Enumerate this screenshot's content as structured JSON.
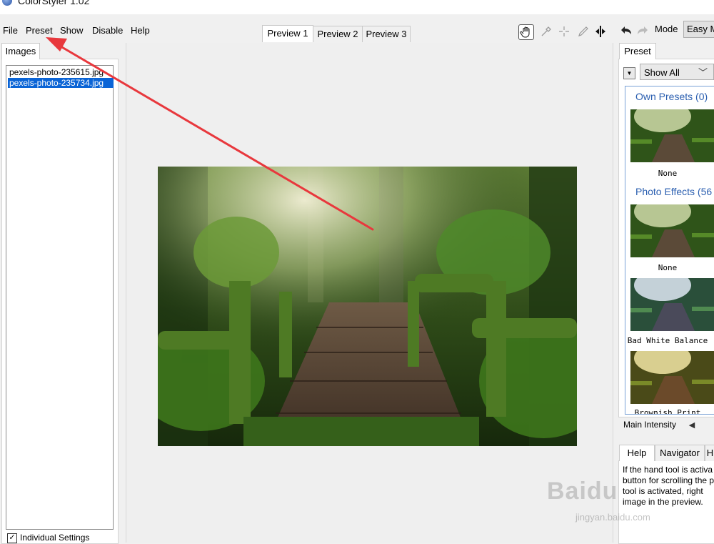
{
  "window": {
    "title": "ColorStyler 1.02"
  },
  "menu": [
    "File",
    "Preset",
    "Show",
    "Disable",
    "Help"
  ],
  "preview_tabs": [
    "Preview 1",
    "Preview 2",
    "Preview 3"
  ],
  "active_preview_tab": "Preview 1",
  "toolbar": {
    "tools": [
      "hand-icon",
      "eyedropper-icon",
      "crosshair-icon",
      "brush-icon",
      "split-view-icon"
    ],
    "mode_label": "Mode",
    "mode_value": "Easy M"
  },
  "images_panel": {
    "tab_label": "Images",
    "files": [
      {
        "name": "pexels-photo-235615.jpg",
        "selected": false
      },
      {
        "name": "pexels-photo-235734.jpg",
        "selected": true
      }
    ],
    "individual_settings": {
      "label": "Individual Settings",
      "checked": true
    }
  },
  "preset_panel": {
    "tab_label": "Preset",
    "filter_value": "Show All",
    "sections": [
      {
        "title": "Own Presets (0)",
        "presets": [
          "None"
        ]
      },
      {
        "title": "Photo Effects (56",
        "presets": [
          "None",
          "Bad White Balance",
          "Brownish Print"
        ]
      }
    ]
  },
  "main_intensity_label": "Main Intensity",
  "bottom_tabs": [
    "Help",
    "Navigator",
    "H"
  ],
  "help_text": "If the hand tool is activa\nbutton for scrolling the p\ntool is activated, right\nimage in the preview.",
  "watermark": {
    "brand": "Baidu",
    "url": "jingyan.baidu.com"
  },
  "colors": {
    "selection": "#0a64d6",
    "section_title": "#2b5fb0",
    "annotation_arrow": "#e8383d"
  }
}
